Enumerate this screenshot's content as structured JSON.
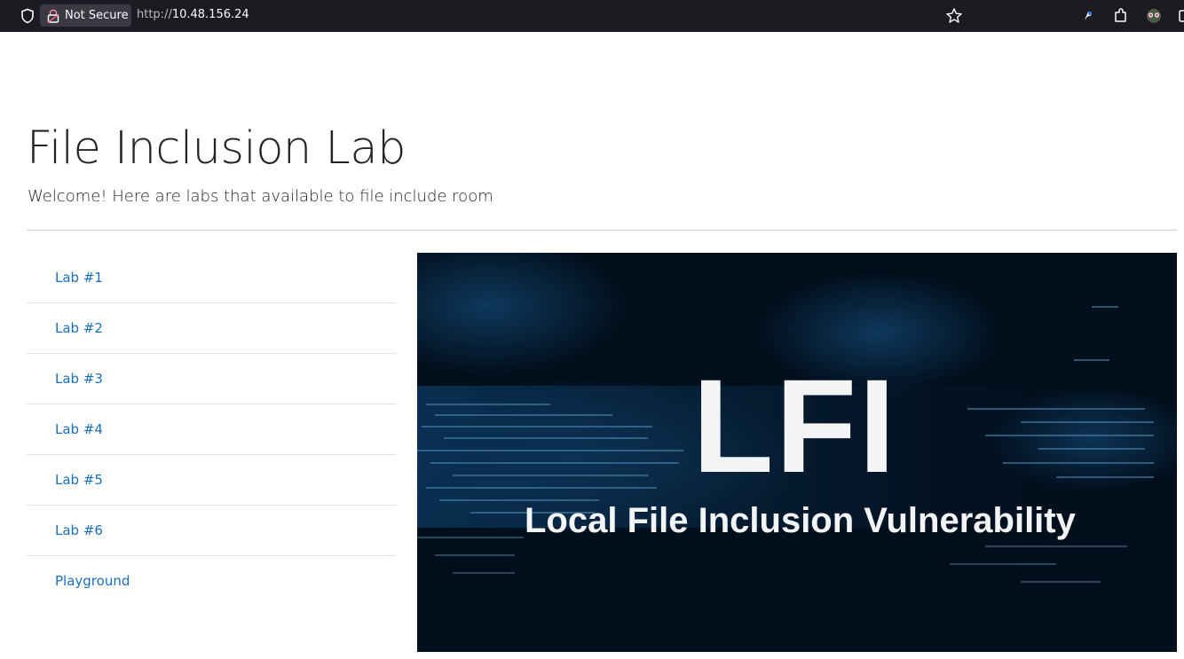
{
  "browser": {
    "security_label": "Not Secure",
    "url_scheme": "http://",
    "url_host": "10.48.156.24"
  },
  "page": {
    "title": "File Inclusion Lab",
    "subtitle": "Welcome! Here are labs that available to file include room"
  },
  "labs": [
    {
      "label": "Lab #1"
    },
    {
      "label": "Lab #2"
    },
    {
      "label": "Lab #3"
    },
    {
      "label": "Lab #4"
    },
    {
      "label": "Lab #5"
    },
    {
      "label": "Lab #6"
    },
    {
      "label": "Playground"
    }
  ],
  "banner": {
    "headline": "LFI",
    "caption": "Local File Inclusion Vulnerability"
  },
  "colors": {
    "link": "#1a6fbd",
    "browser_bar": "#1c1b22",
    "banner_bg": "#02101d"
  }
}
